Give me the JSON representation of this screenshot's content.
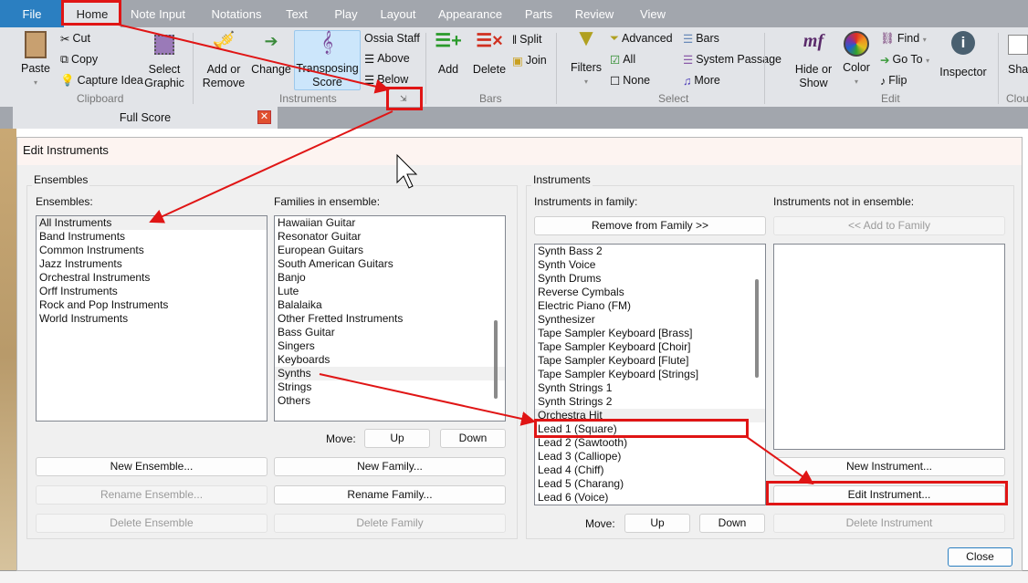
{
  "menu_tabs": [
    "File",
    "Home",
    "Note Input",
    "Notations",
    "Text",
    "Play",
    "Layout",
    "Appearance",
    "Parts",
    "Review",
    "View"
  ],
  "ribbon": {
    "clipboard": {
      "paste": "Paste",
      "cut": "Cut",
      "copy": "Copy",
      "capture_idea": "Capture Idea",
      "select_graphic_1": "Select",
      "select_graphic_2": "Graphic",
      "group": "Clipboard"
    },
    "instruments": {
      "add_remove_1": "Add or",
      "add_remove_2": "Remove",
      "change": "Change",
      "transposing_1": "Transposing",
      "transposing_2": "Score",
      "ossia_staff": "Ossia Staff",
      "above": "Above",
      "below": "Below",
      "group": "Instruments"
    },
    "bars": {
      "add": "Add",
      "delete": "Delete",
      "split": "Split",
      "join": "Join",
      "group": "Bars"
    },
    "select": {
      "filters": "Filters",
      "advanced": "Advanced",
      "all": "All",
      "none": "None",
      "bars": "Bars",
      "system_passage": "System Passage",
      "more": "More",
      "group": "Select"
    },
    "edit": {
      "hide_show_1": "Hide or",
      "hide_show_2": "Show",
      "color": "Color",
      "find": "Find",
      "go_to": "Go To",
      "flip": "Flip",
      "inspector": "Inspector",
      "group": "Edit"
    },
    "cloud": {
      "share": "Sha",
      "group": "Clou"
    }
  },
  "document_tab": {
    "label": "Full Score"
  },
  "dialog": {
    "title": "Edit Instruments",
    "ensembles_group": "Ensembles",
    "ensembles_label": "Ensembles:",
    "ensembles": [
      "All Instruments",
      "Band Instruments",
      "Common Instruments",
      "Jazz Instruments",
      "Orchestral Instruments",
      "Orff Instruments",
      "Rock and Pop Instruments",
      "World Instruments"
    ],
    "families_label": "Families in ensemble:",
    "families": [
      "Hawaiian Guitar",
      "Resonator Guitar",
      "European Guitars",
      "South American Guitars",
      "Banjo",
      "Lute",
      "Balalaika",
      "Other Fretted Instruments",
      "Bass Guitar",
      "Singers",
      "Keyboards",
      "Synths",
      "Strings",
      "Others"
    ],
    "move_label": "Move:",
    "up": "Up",
    "down": "Down",
    "new_ensemble": "New Ensemble...",
    "rename_ensemble": "Rename Ensemble...",
    "delete_ensemble": "Delete Ensemble",
    "new_family": "New Family...",
    "rename_family": "Rename Family...",
    "delete_family": "Delete Family",
    "instruments_group": "Instruments",
    "in_family_label": "Instruments in family:",
    "not_in_ensemble_label": "Instruments not in ensemble:",
    "remove_from_family": "Remove from Family >>",
    "add_to_family": "<< Add to Family",
    "instruments": [
      "Synth Bass 2",
      "Synth Voice",
      "Synth Drums",
      "Reverse Cymbals",
      "Electric Piano (FM)",
      "Synthesizer",
      "Tape Sampler Keyboard [Brass]",
      "Tape Sampler Keyboard [Choir]",
      "Tape Sampler Keyboard [Flute]",
      "Tape Sampler Keyboard [Strings]",
      "Synth Strings 1",
      "Synth Strings 2",
      "Orchestra Hit",
      "Lead 1 (Square)",
      "Lead 2 (Sawtooth)",
      "Lead 3 (Calliope)",
      "Lead 4 (Chiff)",
      "Lead 5 (Charang)",
      "Lead 6 (Voice)"
    ],
    "new_instrument": "New Instrument...",
    "edit_instrument": "Edit Instrument...",
    "delete_instrument": "Delete Instrument",
    "close": "Close"
  },
  "annotation_color": "#e01515"
}
